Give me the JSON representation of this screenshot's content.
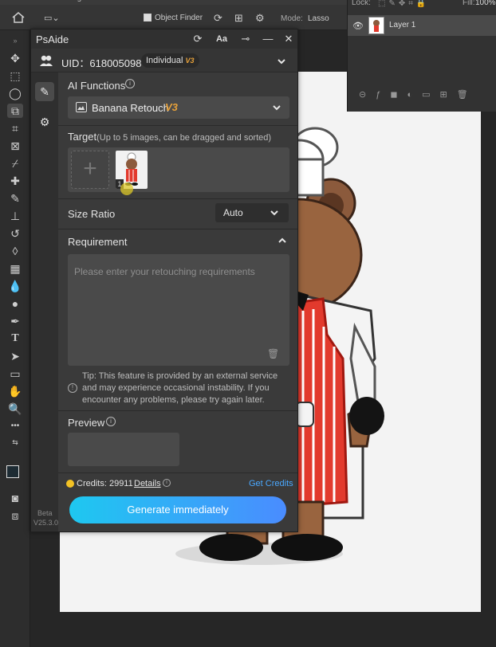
{
  "photoshop": {
    "options_bar": {
      "object_finder_label": "Object Finder",
      "mode_label": "Mode:",
      "lasso_label": "Lasso"
    },
    "layers": {
      "lock_label": "Lock:",
      "fill_label": "Fill:",
      "fill_value": "100%",
      "layer_name": "Layer 1"
    }
  },
  "plugin": {
    "title": "PsAide",
    "uid_label": "UID：618005098",
    "plan_badge": "Individual",
    "plan_badge_version": "V3",
    "ai_functions_label": "AI Functions",
    "function_select": {
      "value": "Banana Retouch",
      "version_tag": "V3"
    },
    "target": {
      "label": "Target",
      "hint": "(Up to 5 images, can be dragged and sorted)",
      "thumbnail_index": "1"
    },
    "size_ratio": {
      "label": "Size Ratio",
      "value": "Auto"
    },
    "requirement": {
      "label": "Requirement",
      "placeholder": "Please enter your retouching requirements",
      "tip": "Tip: This feature is provided by an external service and may experience occasional instability. If you encounter any problems, please try again later."
    },
    "preview_label": "Preview",
    "credits": {
      "label": "Credits: 29911",
      "details_link": "Details",
      "get_credits_link": "Get Credits"
    },
    "generate_button": "Generate immediately",
    "beta_label": "Beta",
    "version_label": "V25.3.0"
  },
  "colors": {
    "accent_gradient_start": "#1ec8f0",
    "accent_gradient_end": "#4a8cff",
    "version_tag": "#e8a23a",
    "link": "#4aa8ff",
    "coin": "#f3c225"
  }
}
